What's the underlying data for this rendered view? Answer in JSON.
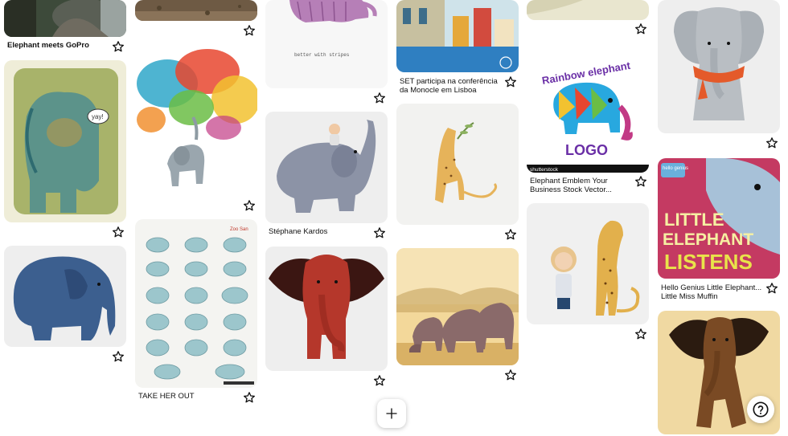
{
  "colors": {
    "background": "#ffffff",
    "card_bg": "#efefef",
    "text": "#111111"
  },
  "icons": {
    "save": "star-outline-icon",
    "add": "plus-icon",
    "help": "question-mark-icon"
  },
  "pins": {
    "c1_top": {
      "caption": "Elephant meets GoPro"
    },
    "c2_bottom": {
      "caption": "TAKE HER OUT"
    },
    "c3_mid": {
      "caption": "Stéphane Kardos"
    },
    "c4_top": {
      "caption_line1": "SET participa na conferência",
      "caption_line2": "da Monocle em Lisboa"
    },
    "c5_mid": {
      "caption_line1": "Elephant Emblem Your",
      "caption_line2": "Business Stock Vector...",
      "image_title_line1": "Rainbow elephant",
      "image_title_line2": "LOGO",
      "image_watermark": "shutterstock"
    },
    "c6_mid": {
      "caption_line1": "Hello Genius Little Elephant...",
      "caption_line2": "Little Miss Muffin",
      "book_title_1": "LITTLE",
      "book_title_2": "ELEPHANT",
      "book_title_3": "LISTENS",
      "book_brand": "hello genius"
    },
    "c2_sketch": {
      "image_label": "Zoo San"
    },
    "c3_top": {
      "image_text": "better with stripes"
    },
    "c1_mid": {
      "image_text": "yay!"
    }
  }
}
